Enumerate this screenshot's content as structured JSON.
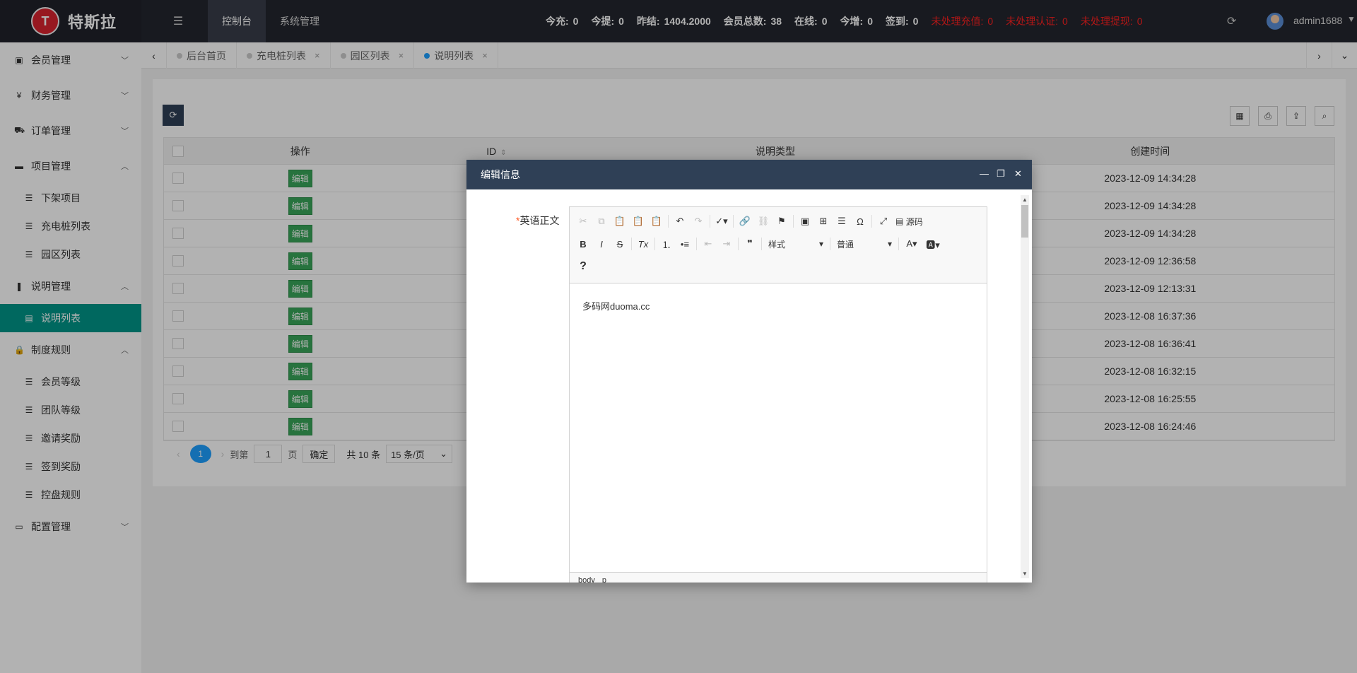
{
  "app": {
    "logo_badge": "T",
    "name": "特斯拉"
  },
  "top_nav": [
    "控制台",
    "系统管理"
  ],
  "stats": [
    {
      "label": "今充:",
      "value": "0",
      "red": false
    },
    {
      "label": "今提:",
      "value": "0",
      "red": false
    },
    {
      "label": "昨结:",
      "value": "1404.2000",
      "red": false
    },
    {
      "label": "会员总数:",
      "value": "38",
      "red": false
    },
    {
      "label": "在线:",
      "value": "0",
      "red": false
    },
    {
      "label": "今增:",
      "value": "0",
      "red": false
    },
    {
      "label": "签到:",
      "value": "0",
      "red": false
    },
    {
      "label": "未处理充值:",
      "value": "0",
      "red": true
    },
    {
      "label": "未处理认证:",
      "value": "0",
      "red": true
    },
    {
      "label": "未处理提现:",
      "value": "0",
      "red": true
    }
  ],
  "user": {
    "name": "admin1688"
  },
  "sidebar": {
    "groups": [
      {
        "label": "会员管理",
        "icon": "member-icon",
        "expanded": false,
        "items": []
      },
      {
        "label": "财务管理",
        "icon": "yen-icon",
        "expanded": false,
        "items": []
      },
      {
        "label": "订单管理",
        "icon": "cart-icon",
        "expanded": false,
        "items": []
      },
      {
        "label": "项目管理",
        "icon": "briefcase-icon",
        "expanded": true,
        "items": [
          "下架项目",
          "充电桩列表",
          "园区列表"
        ]
      },
      {
        "label": "说明管理",
        "icon": "bookmark-icon",
        "expanded": true,
        "items": [
          "说明列表"
        ]
      },
      {
        "label": "制度规则",
        "icon": "lock-icon",
        "expanded": true,
        "items": [
          "会员等级",
          "团队等级",
          "邀请奖励",
          "签到奖励",
          "控盘规则"
        ]
      },
      {
        "label": "配置管理",
        "icon": "card-icon",
        "expanded": false,
        "items": []
      }
    ],
    "active_item": "说明列表"
  },
  "tabs": [
    {
      "label": "后台首页",
      "closable": false,
      "active": false
    },
    {
      "label": "充电桩列表",
      "closable": true,
      "active": false
    },
    {
      "label": "园区列表",
      "closable": true,
      "active": false
    },
    {
      "label": "说明列表",
      "closable": true,
      "active": true
    }
  ],
  "table": {
    "headers": [
      "操作",
      "ID",
      "说明类型",
      "创建时间"
    ],
    "edit_label": "编辑",
    "rows": [
      "2023-12-09 14:34:28",
      "2023-12-09 14:34:28",
      "2023-12-09 14:34:28",
      "2023-12-09 12:36:58",
      "2023-12-09 12:13:31",
      "2023-12-08 16:37:36",
      "2023-12-08 16:36:41",
      "2023-12-08 16:32:15",
      "2023-12-08 16:25:55",
      "2023-12-08 16:24:46"
    ]
  },
  "pager": {
    "current": "1",
    "goto_label": "到第",
    "page_input": "1",
    "page_unit": "页",
    "ok_label": "确定",
    "total": "共 10 条",
    "size": "15 条/页"
  },
  "modal": {
    "title": "编辑信息",
    "field_required_mark": "*",
    "field_label": "英语正文",
    "content": "多码网duoma.cc",
    "source_label": "源码",
    "style_combo": "样式",
    "format_combo": "普通",
    "status_path": [
      "body",
      "p"
    ]
  }
}
